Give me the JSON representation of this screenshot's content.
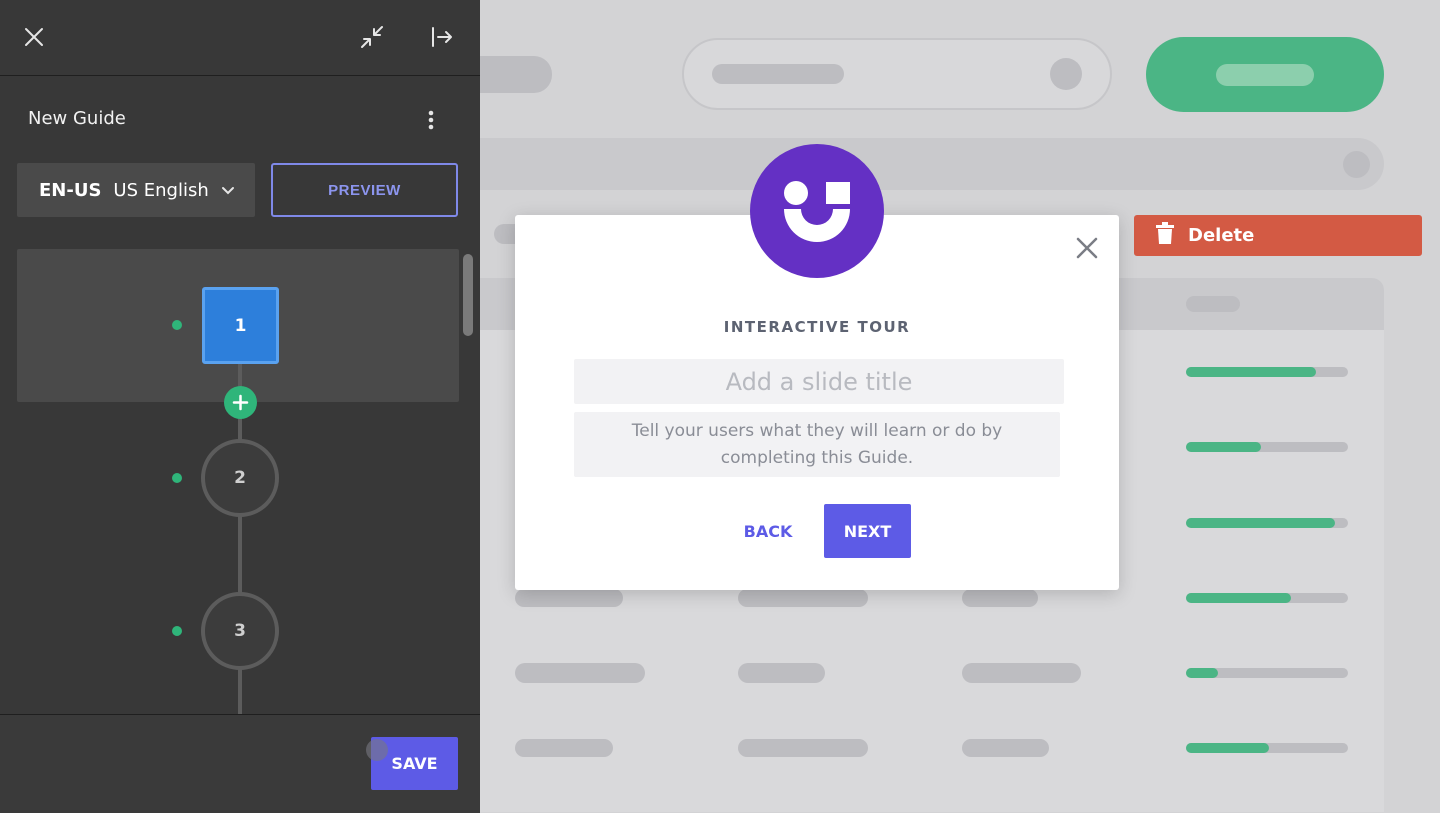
{
  "editor": {
    "guide_name": "New Guide",
    "language_code": "EN-US",
    "language_name": "US English",
    "preview_label": "PREVIEW",
    "save_label": "SAVE",
    "steps": [
      {
        "number": "1",
        "active": true
      },
      {
        "number": "2",
        "active": false
      },
      {
        "number": "3",
        "active": false
      }
    ],
    "icons": {
      "close": "close-icon",
      "collapse": "collapse-icon",
      "dock": "dock-right-icon",
      "more": "kebab-menu-icon",
      "language": "chevron-down-icon",
      "add_step": "plus-icon"
    }
  },
  "background_app": {
    "delete_label": "Delete",
    "progress_values": [
      0.8,
      0.46,
      0.92,
      0.65,
      0.2,
      0.51
    ],
    "colors": {
      "primary": "#4bb585",
      "danger": "#d35a44"
    }
  },
  "modal": {
    "heading": "INTERACTIVE TOUR",
    "title_placeholder": "Add a slide title",
    "description_placeholder": "Tell your users what they will learn or do by completing this Guide.",
    "back_label": "BACK",
    "next_label": "NEXT",
    "brand_color": "#6430c4",
    "accent_color": "#5d5be6"
  }
}
